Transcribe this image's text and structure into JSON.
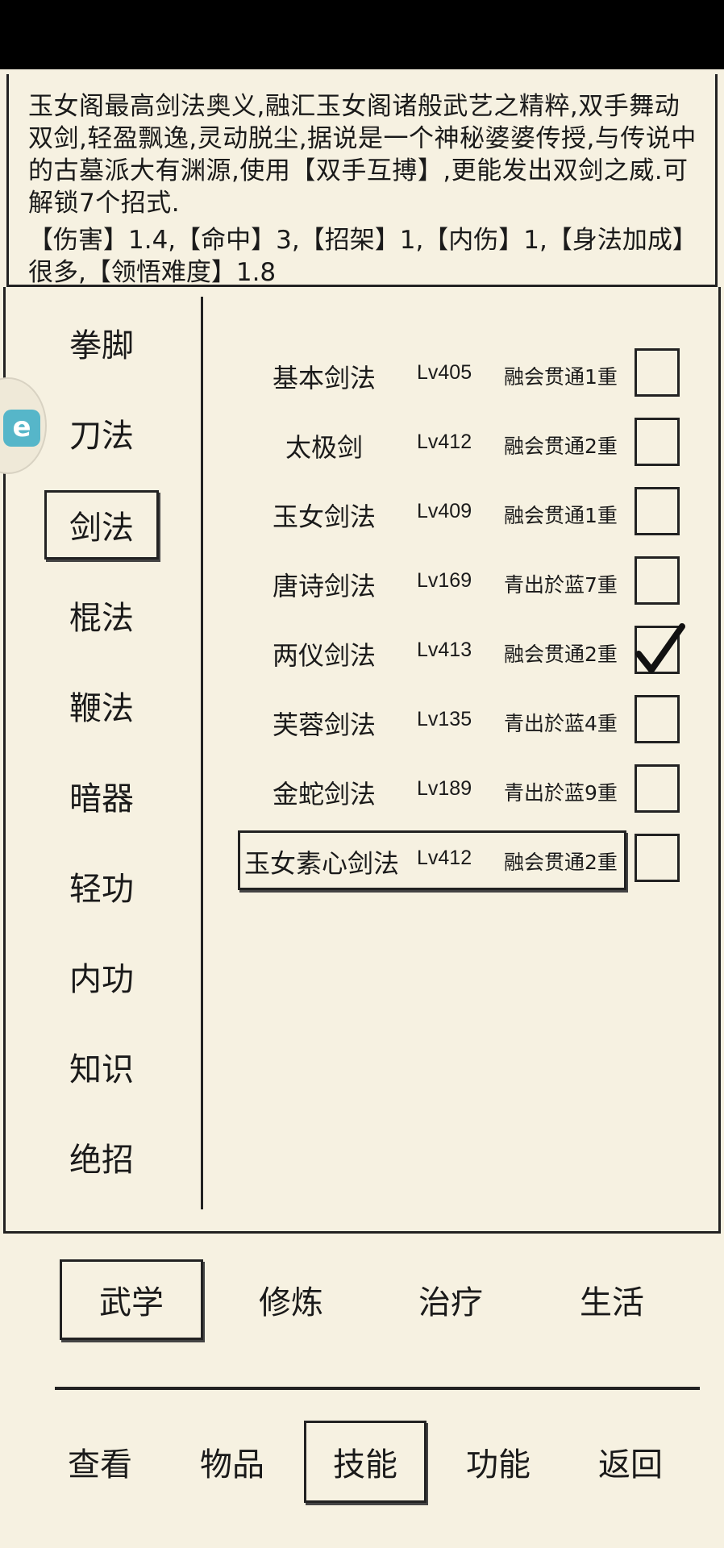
{
  "description": {
    "text": "玉女阁最高剑法奥义,融汇玉女阁诸般武艺之精粹,双手舞动双剑,轻盈飘逸,灵动脱尘,据说是一个神秘婆婆传授,与传说中的古墓派大有渊源,使用【双手互搏】,更能发出双剑之威.可解锁7个招式.",
    "stats_line1": "【伤害】1.4,【命中】3,【招架】1,【内伤】1,【身法加成】",
    "stats_line2": "很多,【领悟难度】1.8"
  },
  "categories": [
    {
      "label": "拳脚"
    },
    {
      "label": "刀法"
    },
    {
      "label": "剑法",
      "active": true
    },
    {
      "label": "棍法"
    },
    {
      "label": "鞭法"
    },
    {
      "label": "暗器"
    },
    {
      "label": "轻功"
    },
    {
      "label": "内功"
    },
    {
      "label": "知识"
    },
    {
      "label": "绝招"
    }
  ],
  "skills": [
    {
      "name": "基本剑法",
      "level": "Lv405",
      "stage": "融会贯通1重",
      "checked": false
    },
    {
      "name": "太极剑",
      "level": "Lv412",
      "stage": "融会贯通2重",
      "checked": false
    },
    {
      "name": "玉女剑法",
      "level": "Lv409",
      "stage": "融会贯通1重",
      "checked": false
    },
    {
      "name": "唐诗剑法",
      "level": "Lv169",
      "stage": "青出於蓝7重",
      "checked": false
    },
    {
      "name": "两仪剑法",
      "level": "Lv413",
      "stage": "融会贯通2重",
      "checked": true
    },
    {
      "name": "芙蓉剑法",
      "level": "Lv135",
      "stage": "青出於蓝4重",
      "checked": false
    },
    {
      "name": "金蛇剑法",
      "level": "Lv189",
      "stage": "青出於蓝9重",
      "checked": false
    },
    {
      "name": "玉女素心剑法",
      "level": "Lv412",
      "stage": "融会贯通2重",
      "checked": false,
      "selected": true
    }
  ],
  "subtabs": [
    {
      "label": "武学",
      "active": true
    },
    {
      "label": "修炼"
    },
    {
      "label": "治疗"
    },
    {
      "label": "生活"
    }
  ],
  "nav": [
    {
      "label": "查看"
    },
    {
      "label": "物品"
    },
    {
      "label": "技能",
      "active": true
    },
    {
      "label": "功能"
    },
    {
      "label": "返回"
    }
  ],
  "floating_button": {
    "icon": "app-logo-icon",
    "glyph": "e"
  }
}
